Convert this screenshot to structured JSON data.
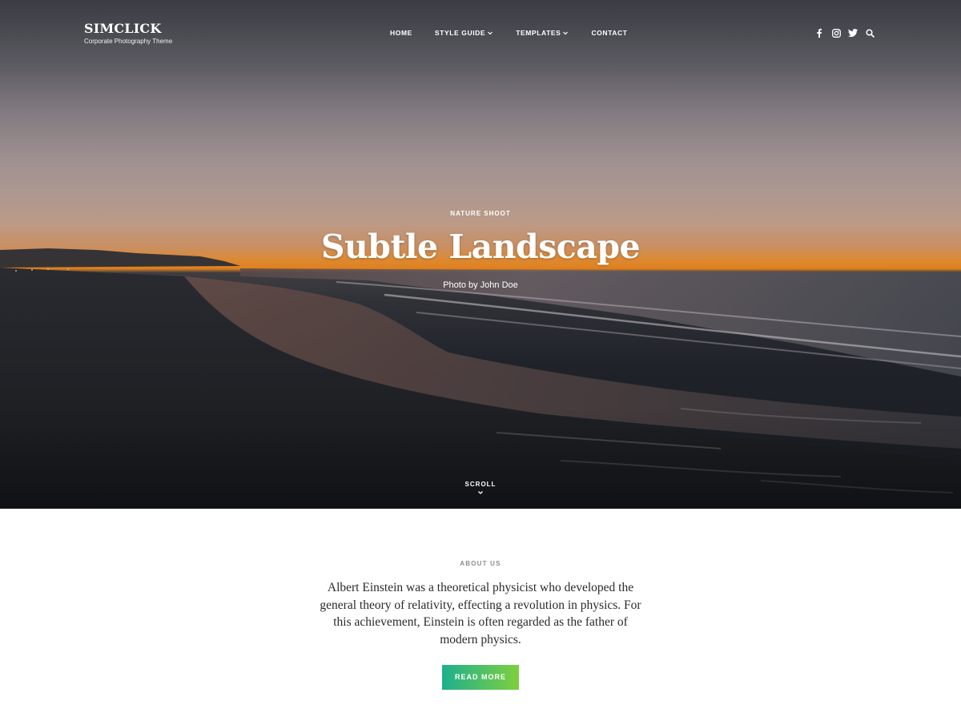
{
  "header": {
    "site_title": "SIMCLICK",
    "tagline": "Corporate Photography Theme",
    "nav": {
      "home": "HOME",
      "style_guide": "STYLE GUIDE",
      "templates": "TEMPLATES",
      "contact": "CONTACT"
    },
    "social_icons": [
      "facebook-icon",
      "instagram-icon",
      "twitter-icon",
      "search-icon"
    ]
  },
  "hero": {
    "category": "NATURE SHOOT",
    "title": "Subtle Landscape",
    "credit": "Photo by John Doe",
    "scroll_label": "SCROLL"
  },
  "about": {
    "heading": "ABOUT US",
    "text": "Albert Einstein was a theoretical physicist who developed the general theory of relativity, effecting a revolution in physics. For this achievement, Einstein is often regarded as the father of modern physics.",
    "button_label": "READ MORE"
  },
  "colors": {
    "button_gradient_start": "#1db08d",
    "button_gradient_end": "#7fcf3e",
    "horizon_orange": "#e0801d"
  }
}
